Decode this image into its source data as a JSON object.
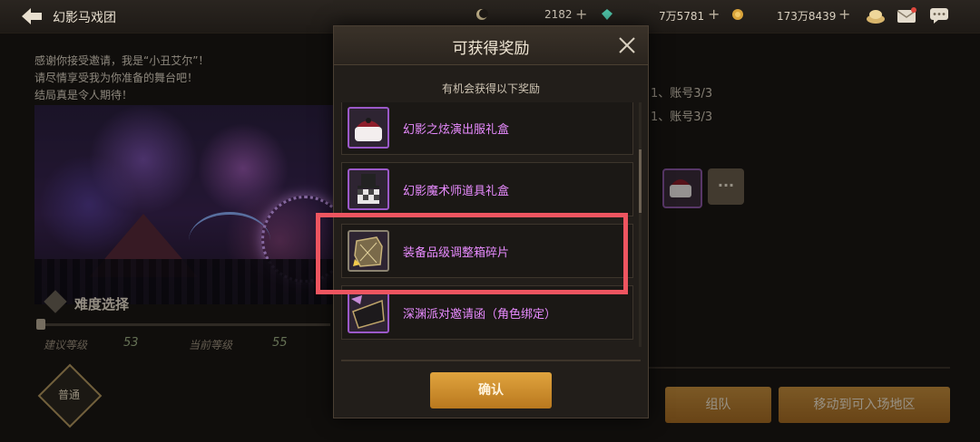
{
  "header": {
    "title": "幻影马戏团",
    "resources": [
      {
        "icon": "moon-currency-icon",
        "value": "2182"
      },
      {
        "icon": "green-gem-icon",
        "value": "7万5781"
      },
      {
        "icon": "gold-coin-icon",
        "value": "173万8439"
      }
    ],
    "plus": "+",
    "icons": [
      "cake-icon",
      "mail-icon",
      "chat-icon"
    ]
  },
  "left_panel": {
    "intro_lines": [
      "感谢你接受邀请，我是“小丑艾尔”！",
      "请尽情享受我为你准备的舞台吧！",
      "结局真是令人期待！"
    ],
    "difficulty_title": "难度选择",
    "recommended_label": "建议等级",
    "recommended_value": "53",
    "current_label": "当前等级",
    "current_value": "55",
    "difficulty_button": "普通"
  },
  "right_panel": {
    "account_lines": [
      "1、账号3/3",
      "1、账号3/3"
    ],
    "more": "···",
    "team_button": "组队",
    "move_button": "移动到可入场地区"
  },
  "modal": {
    "title": "可获得奖励",
    "subtitle": "有机会获得以下奖励",
    "items": [
      {
        "name": "幻影之炫演出服礼盒",
        "icon": "costume-box-icon"
      },
      {
        "name": "幻影魔术师道具礼盒",
        "icon": "magician-hat-box-icon"
      },
      {
        "name": "装备品级调整箱碎片",
        "icon": "gear-box-fragment-icon"
      },
      {
        "name": "深渊派对邀请函（角色绑定）",
        "icon": "abyss-invitation-icon"
      }
    ],
    "confirm": "确认"
  },
  "colors": {
    "highlight": "#ee5560",
    "item_name": "#e88bff",
    "accent_button": "#c98f36"
  }
}
